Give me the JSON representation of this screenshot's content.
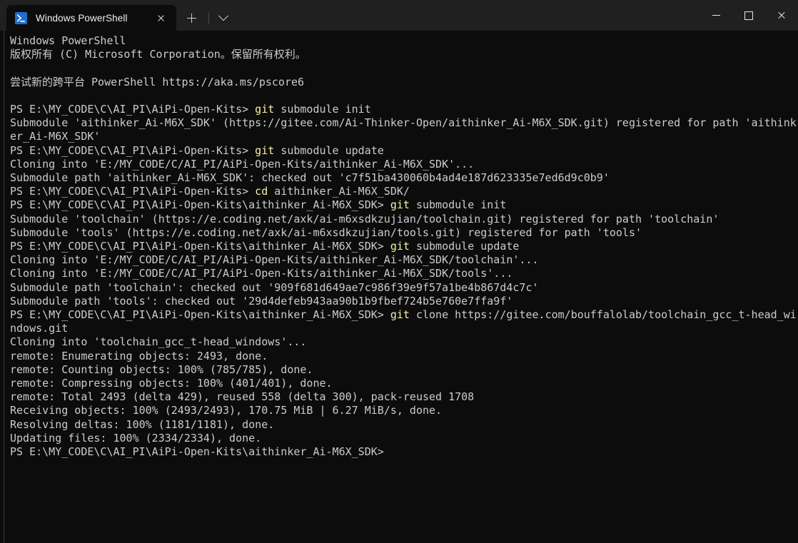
{
  "window": {
    "titlebar": {
      "tab": {
        "title": "Windows PowerShell",
        "icon": "powershell-icon",
        "close_label": "×"
      },
      "new_tab_label": "+",
      "dropdown_label": "⌄",
      "minimize_label": "—",
      "maximize_label": "□",
      "close_label": "✕"
    },
    "colors": {
      "titlebar_bg": "#202020",
      "terminal_bg": "#0c0c0c",
      "terminal_fg": "#cccccc",
      "command_highlight": "#f9f1a5",
      "tab_icon_blue": "#1f6fd0"
    }
  },
  "terminal": {
    "prompt_prefix_root": "PS E:\\MY_CODE\\C\\AI_PI\\AiPi-Open-Kits> ",
    "prompt_prefix_sdk": "PS E:\\MY_CODE\\C\\AI_PI\\AiPi-Open-Kits\\aithinker_Ai-M6X_SDK> ",
    "lines": [
      {
        "segments": [
          {
            "text": "Windows PowerShell",
            "style": "txt"
          }
        ]
      },
      {
        "segments": [
          {
            "text": "版权所有 (C) Microsoft Corporation。保留所有权利。",
            "style": "txt"
          }
        ]
      },
      {
        "segments": [
          {
            "text": "",
            "style": "txt"
          }
        ]
      },
      {
        "segments": [
          {
            "text": "尝试新的跨平台 PowerShell https://aka.ms/pscore6",
            "style": "txt"
          }
        ]
      },
      {
        "segments": [
          {
            "text": "",
            "style": "txt"
          }
        ]
      },
      {
        "segments": [
          {
            "text": "PS E:\\MY_CODE\\C\\AI_PI\\AiPi-Open-Kits> ",
            "style": "txt"
          },
          {
            "text": "git",
            "style": "cmd"
          },
          {
            "text": " submodule init",
            "style": "txt"
          }
        ]
      },
      {
        "segments": [
          {
            "text": "Submodule 'aithinker_Ai-M6X_SDK' (https://gitee.com/Ai-Thinker-Open/aithinker_Ai-M6X_SDK.git) registered for path 'aithinker_Ai-M6X_SDK'",
            "style": "txt"
          }
        ]
      },
      {
        "segments": [
          {
            "text": "PS E:\\MY_CODE\\C\\AI_PI\\AiPi-Open-Kits> ",
            "style": "txt"
          },
          {
            "text": "git",
            "style": "cmd"
          },
          {
            "text": " submodule update",
            "style": "txt"
          }
        ]
      },
      {
        "segments": [
          {
            "text": "Cloning into 'E:/MY_CODE/C/AI_PI/AiPi-Open-Kits/aithinker_Ai-M6X_SDK'...",
            "style": "txt"
          }
        ]
      },
      {
        "segments": [
          {
            "text": "Submodule path 'aithinker_Ai-M6X_SDK': checked out 'c7f51ba430060b4ad4e187d623335e7ed6d9c0b9'",
            "style": "txt"
          }
        ]
      },
      {
        "segments": [
          {
            "text": "PS E:\\MY_CODE\\C\\AI_PI\\AiPi-Open-Kits> ",
            "style": "txt"
          },
          {
            "text": "cd",
            "style": "cmd"
          },
          {
            "text": " aithinker_Ai-M6X_SDK/",
            "style": "txt"
          }
        ]
      },
      {
        "segments": [
          {
            "text": "PS E:\\MY_CODE\\C\\AI_PI\\AiPi-Open-Kits\\aithinker_Ai-M6X_SDK> ",
            "style": "txt"
          },
          {
            "text": "git",
            "style": "cmd"
          },
          {
            "text": " submodule init",
            "style": "txt"
          }
        ]
      },
      {
        "segments": [
          {
            "text": "Submodule 'toolchain' (https://e.coding.net/axk/ai-m6xsdkzujian/toolchain.git) registered for path 'toolchain'",
            "style": "txt"
          }
        ]
      },
      {
        "segments": [
          {
            "text": "Submodule 'tools' (https://e.coding.net/axk/ai-m6xsdkzujian/tools.git) registered for path 'tools'",
            "style": "txt"
          }
        ]
      },
      {
        "segments": [
          {
            "text": "PS E:\\MY_CODE\\C\\AI_PI\\AiPi-Open-Kits\\aithinker_Ai-M6X_SDK> ",
            "style": "txt"
          },
          {
            "text": "git",
            "style": "cmd"
          },
          {
            "text": " submodule update",
            "style": "txt"
          }
        ]
      },
      {
        "segments": [
          {
            "text": "Cloning into 'E:/MY_CODE/C/AI_PI/AiPi-Open-Kits/aithinker_Ai-M6X_SDK/toolchain'...",
            "style": "txt"
          }
        ]
      },
      {
        "segments": [
          {
            "text": "Cloning into 'E:/MY_CODE/C/AI_PI/AiPi-Open-Kits/aithinker_Ai-M6X_SDK/tools'...",
            "style": "txt"
          }
        ]
      },
      {
        "segments": [
          {
            "text": "Submodule path 'toolchain': checked out '909f681d649ae7c986f39e9f57a1be4b867d4c7c'",
            "style": "txt"
          }
        ]
      },
      {
        "segments": [
          {
            "text": "Submodule path 'tools': checked out '29d4defeb943aa90b1b9fbef724b5e760e7ffa9f'",
            "style": "txt"
          }
        ]
      },
      {
        "segments": [
          {
            "text": "PS E:\\MY_CODE\\C\\AI_PI\\AiPi-Open-Kits\\aithinker_Ai-M6X_SDK> ",
            "style": "txt"
          },
          {
            "text": "git",
            "style": "cmd"
          },
          {
            "text": " clone https://gitee.com/bouffalolab/toolchain_gcc_t-head_windows.git",
            "style": "txt"
          }
        ]
      },
      {
        "segments": [
          {
            "text": "Cloning into 'toolchain_gcc_t-head_windows'...",
            "style": "txt"
          }
        ]
      },
      {
        "segments": [
          {
            "text": "remote: Enumerating objects: 2493, done.",
            "style": "txt"
          }
        ]
      },
      {
        "segments": [
          {
            "text": "remote: Counting objects: 100% (785/785), done.",
            "style": "txt"
          }
        ]
      },
      {
        "segments": [
          {
            "text": "remote: Compressing objects: 100% (401/401), done.",
            "style": "txt"
          }
        ]
      },
      {
        "segments": [
          {
            "text": "remote: Total 2493 (delta 429), reused 558 (delta 300), pack-reused 1708",
            "style": "txt"
          }
        ]
      },
      {
        "segments": [
          {
            "text": "Receiving objects: 100% (2493/2493), 170.75 MiB | 6.27 MiB/s, done.",
            "style": "txt"
          }
        ]
      },
      {
        "segments": [
          {
            "text": "Resolving deltas: 100% (1181/1181), done.",
            "style": "txt"
          }
        ]
      },
      {
        "segments": [
          {
            "text": "Updating files: 100% (2334/2334), done.",
            "style": "txt"
          }
        ]
      },
      {
        "segments": [
          {
            "text": "PS E:\\MY_CODE\\C\\AI_PI\\AiPi-Open-Kits\\aithinker_Ai-M6X_SDK>",
            "style": "txt"
          }
        ]
      }
    ]
  }
}
